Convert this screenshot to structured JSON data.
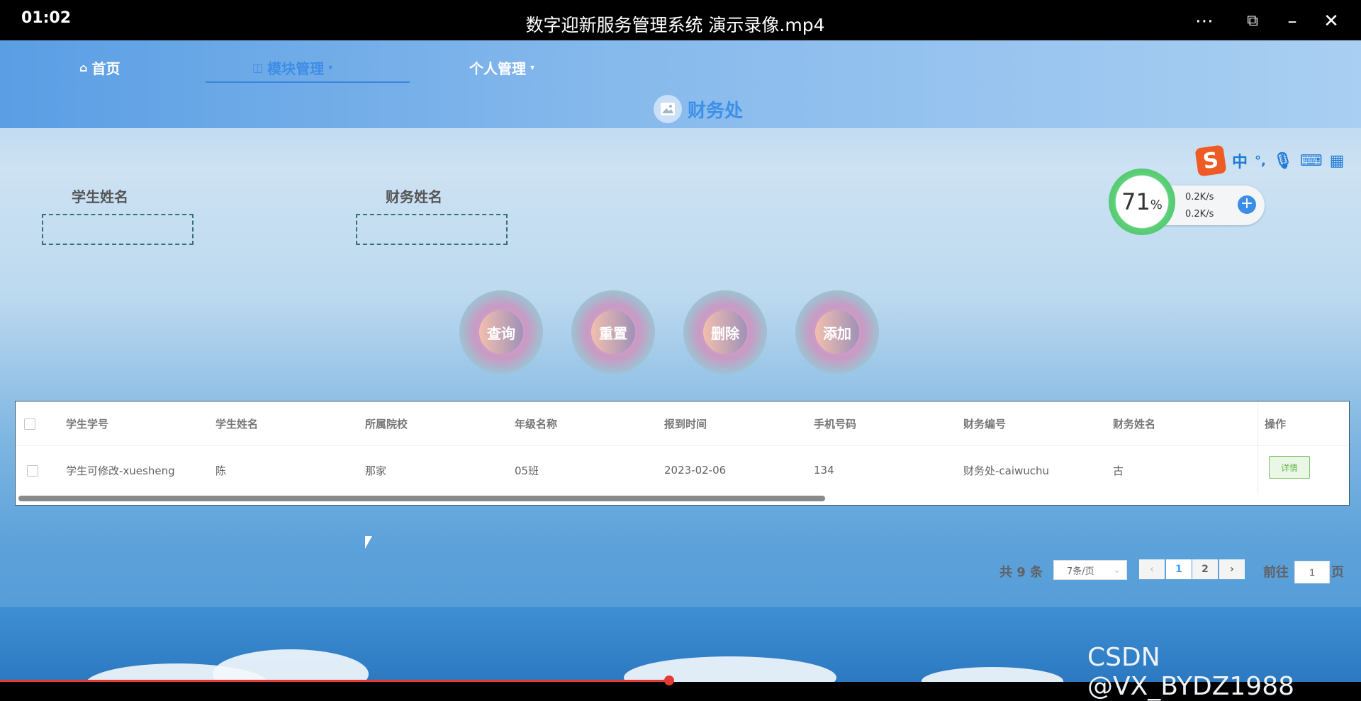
{
  "window": {
    "time": "01:02",
    "title": "数字迎新服务管理系统 演示录像.mp4"
  },
  "nav": {
    "home": "首页",
    "module": "模块管理",
    "personal": "个人管理"
  },
  "page_title": "财务处",
  "filters": {
    "student_name_label": "学生姓名",
    "finance_name_label": "财务姓名"
  },
  "buttons": {
    "query": "查询",
    "reset": "重置",
    "delete": "删除",
    "add": "添加"
  },
  "table": {
    "headers": [
      "学生学号",
      "学生姓名",
      "所属院校",
      "年级名称",
      "报到时间",
      "手机号码",
      "财务编号",
      "财务姓名",
      "操作"
    ],
    "rows": [
      {
        "student_id": "学生可修改-xuesheng",
        "student_name": "陈",
        "college": "那家",
        "grade": "05班",
        "report_time": "2023-02-06",
        "phone": "134",
        "finance_id": "财务处-caiwuchu",
        "finance_name": "古",
        "action": "详情"
      }
    ]
  },
  "pagination": {
    "total": "共 9 条",
    "page_size": "7条/页",
    "pages": [
      "1",
      "2"
    ],
    "current": "1",
    "goto_label": "前往",
    "goto_value": "1",
    "page_unit": "页"
  },
  "ime": {
    "label": "中",
    "punct": "°,"
  },
  "network": {
    "percent": "71",
    "percent_sign": "%",
    "up": "0.2K/s",
    "down": "0.2K/s"
  },
  "watermark": "CSDN @VX_BYDZ1988",
  "colors": {
    "accent": "#3e8fe8",
    "detail_green": "#67b84e",
    "ime_brand": "#ef5b24"
  }
}
